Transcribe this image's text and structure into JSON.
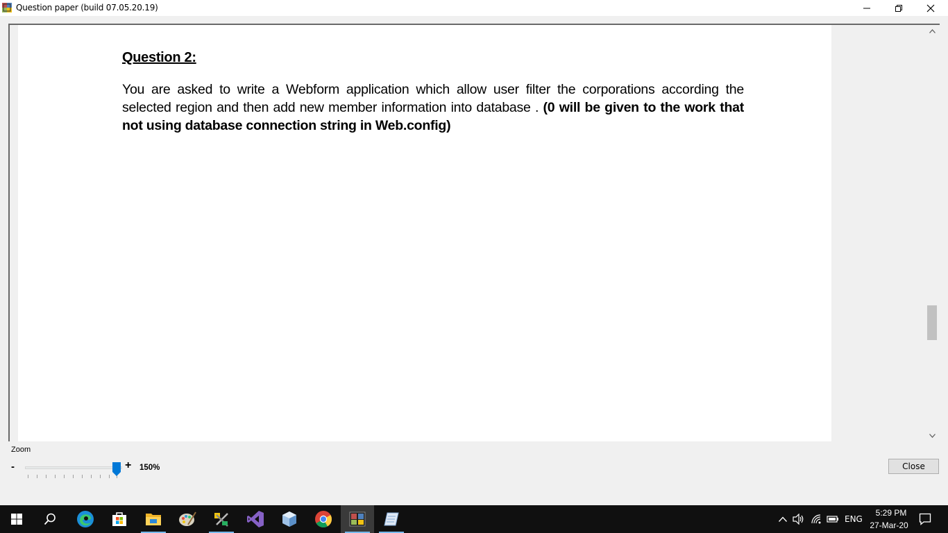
{
  "window": {
    "title": "Question paper (build 07.05.20.19)"
  },
  "document": {
    "question_title": "Question 2:",
    "body_normal": "You are asked to write a Webform application which allow user filter the corporations according the selected region and then add new member information into database . ",
    "body_bold": "(0 will be given to the work that not using database connection string in Web.config)"
  },
  "zoom": {
    "label": "Zoom",
    "minus": "-",
    "plus": "+",
    "value": "150%",
    "level": 1.0
  },
  "buttons": {
    "close": "Close"
  },
  "taskbar": {
    "apps": [
      "start-icon",
      "search-icon",
      "edge-icon",
      "store-icon",
      "file-explorer-icon",
      "paint-icon",
      "tools-icon",
      "visual-studio-icon",
      "virtualbox-icon",
      "chrome-icon",
      "exam-app-icon",
      "notepad-icon"
    ],
    "tray": {
      "language": "ENG",
      "time": "5:29 PM",
      "date": "27-Mar-20"
    }
  },
  "colors": {
    "taskbar_bg": "#101010",
    "indicator": "#76b9ed",
    "slider_thumb": "#0078d7"
  }
}
